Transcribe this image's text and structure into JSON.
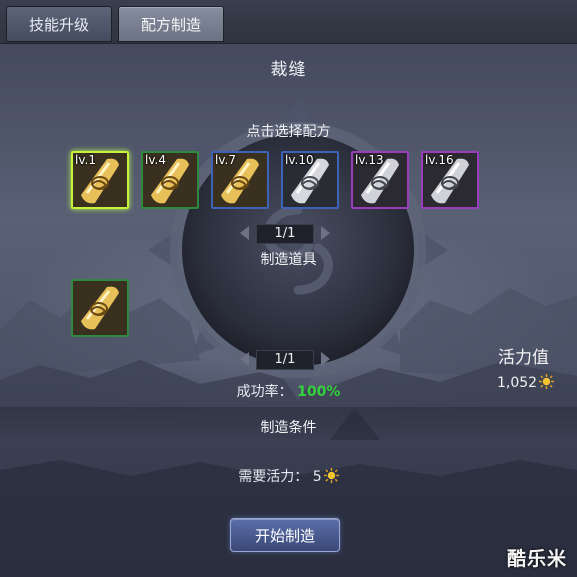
{
  "tabs": [
    {
      "label": "技能升级",
      "active": false
    },
    {
      "label": "配方制造",
      "active": true
    }
  ],
  "title": "裁缝",
  "recipe_section": {
    "label": "点击选择配方",
    "recipes": [
      {
        "level": "lv.1",
        "rarity": "gold",
        "selected": true
      },
      {
        "level": "lv.4",
        "rarity": "gold",
        "selected": false
      },
      {
        "level": "lv.7",
        "rarity": "gold-blue",
        "selected": false
      },
      {
        "level": "lv.10",
        "rarity": "silver-blue",
        "selected": false
      },
      {
        "level": "lv.13",
        "rarity": "silver-purple",
        "selected": false
      },
      {
        "level": "lv.16",
        "rarity": "silver-purple",
        "selected": false
      }
    ],
    "page": "1/1"
  },
  "tool_section": {
    "label": "制造道具",
    "page": "1/1"
  },
  "success": {
    "label": "成功率：",
    "value": "100%"
  },
  "vigor": {
    "label": "活力值",
    "value": "1,052"
  },
  "conditions": {
    "label": "制造条件",
    "need_label": "需要活力：",
    "need_value": "5"
  },
  "start_button": "开始制造",
  "watermark": "酷乐米",
  "colors": {
    "success_green": "#33d23c",
    "selected_border": "#c9f03c",
    "gold": "#e8c05a"
  }
}
